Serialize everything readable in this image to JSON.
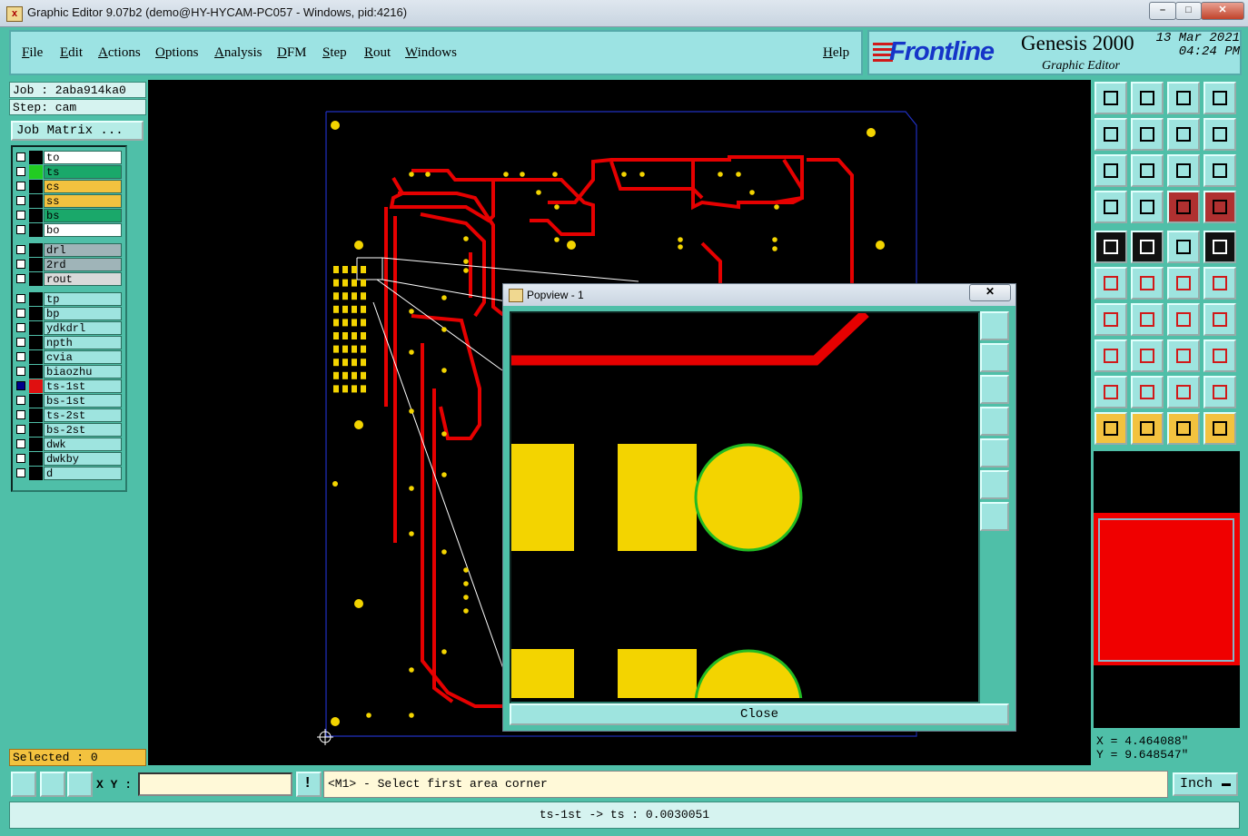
{
  "window": {
    "title": "Graphic Editor 9.07b2 (demo@HY-HYCAM-PC057 - Windows, pid:4216)",
    "min_label": "–",
    "max_label": "□",
    "close_label": "✕"
  },
  "menu": {
    "items": [
      "File",
      "Edit",
      "Actions",
      "Options",
      "Analysis",
      "DFM",
      "Step",
      "Rout",
      "Windows"
    ],
    "help": "Help"
  },
  "brand": {
    "logo": "Frontline",
    "product": "Genesis 2000",
    "subtitle": "Graphic Editor",
    "date": "13 Mar 2021",
    "time": "04:24 PM"
  },
  "job": {
    "job_label": "Job : 2aba914ka0",
    "step_label": "Step: cam",
    "matrix_button": "Job Matrix ..."
  },
  "layers": [
    {
      "name": "to",
      "color": "#ffffff",
      "swatch": "#000000",
      "checked": false
    },
    {
      "name": "ts",
      "color": "#1aa86a",
      "swatch": "#22cc22",
      "checked": false
    },
    {
      "name": "cs",
      "color": "#f3c23f",
      "swatch": "#000000",
      "checked": false
    },
    {
      "name": "ss",
      "color": "#f3c23f",
      "swatch": "#000000",
      "checked": false
    },
    {
      "name": "bs",
      "color": "#1aa86a",
      "swatch": "#000000",
      "checked": false
    },
    {
      "name": "bo",
      "color": "#ffffff",
      "swatch": "#000000",
      "checked": false
    },
    {
      "name": "drl",
      "color": "#9fb4b8",
      "swatch": "#000000",
      "checked": false
    },
    {
      "name": "2rd",
      "color": "#9fb4b8",
      "swatch": "#000000",
      "checked": false
    },
    {
      "name": "rout",
      "color": "#d9d9d9",
      "swatch": "#000000",
      "checked": false
    },
    {
      "name": "tp",
      "color": "#9ee4df",
      "swatch": "#000000",
      "checked": false
    },
    {
      "name": "bp",
      "color": "#9ee4df",
      "swatch": "#000000",
      "checked": false
    },
    {
      "name": "ydkdrl",
      "color": "#9ee4df",
      "swatch": "#000000",
      "checked": false
    },
    {
      "name": "npth",
      "color": "#9ee4df",
      "swatch": "#000000",
      "checked": false
    },
    {
      "name": "cvia",
      "color": "#9ee4df",
      "swatch": "#000000",
      "checked": false
    },
    {
      "name": "biaozhu",
      "color": "#9ee4df",
      "swatch": "#000000",
      "checked": false
    },
    {
      "name": "ts-1st",
      "color": "#9ee4df",
      "swatch": "#e01010",
      "checked": true
    },
    {
      "name": "bs-1st",
      "color": "#9ee4df",
      "swatch": "#000000",
      "checked": false
    },
    {
      "name": "ts-2st",
      "color": "#9ee4df",
      "swatch": "#000000",
      "checked": false
    },
    {
      "name": "bs-2st",
      "color": "#9ee4df",
      "swatch": "#000000",
      "checked": false
    },
    {
      "name": "dwk",
      "color": "#9ee4df",
      "swatch": "#000000",
      "checked": false
    },
    {
      "name": "dwkby",
      "color": "#9ee4df",
      "swatch": "#000000",
      "checked": false
    },
    {
      "name": "d",
      "color": "#9ee4df",
      "swatch": "#000000",
      "checked": false
    }
  ],
  "selected": "Selected : 0",
  "coords": {
    "x": "X = 4.464088\"",
    "y": "Y = 9.648547\""
  },
  "bottom": {
    "xy_label": "X Y :",
    "xy_value": "",
    "message": "<M1> - Select first area corner",
    "unit": "Inch"
  },
  "status": "ts-1st -> ts : 0.0030051",
  "popview": {
    "title": "Popview - 1",
    "close_x": "✕",
    "close_button": "Close"
  },
  "toolbar_icons": [
    "zoom-window",
    "zoom-back",
    "home",
    "split-view",
    "pan-left",
    "pan-right",
    "undo-view",
    "redo-view",
    "fit-all",
    "zoom-fit",
    "scale-1-2",
    "help",
    "measure",
    "grid",
    "snap-a",
    "snap-b",
    "feature-select",
    "clip-area",
    "ruler",
    "spot",
    "connect",
    "cross",
    "move-point",
    "add-point",
    "line-red",
    "line-blue",
    "arc",
    "mirror",
    "node",
    "dash",
    "move-node",
    "overlay",
    "triangle-a",
    "triangle-b",
    "triangle-c",
    "triangle-d",
    "pointer",
    "pointer-box",
    "pointer-circle",
    "pointer-node"
  ],
  "colors": {
    "panel": "#4fbfa8",
    "button": "#9ee4df",
    "trace": "#e60000",
    "pad": "#f3d400",
    "outline": "#2030c0"
  }
}
